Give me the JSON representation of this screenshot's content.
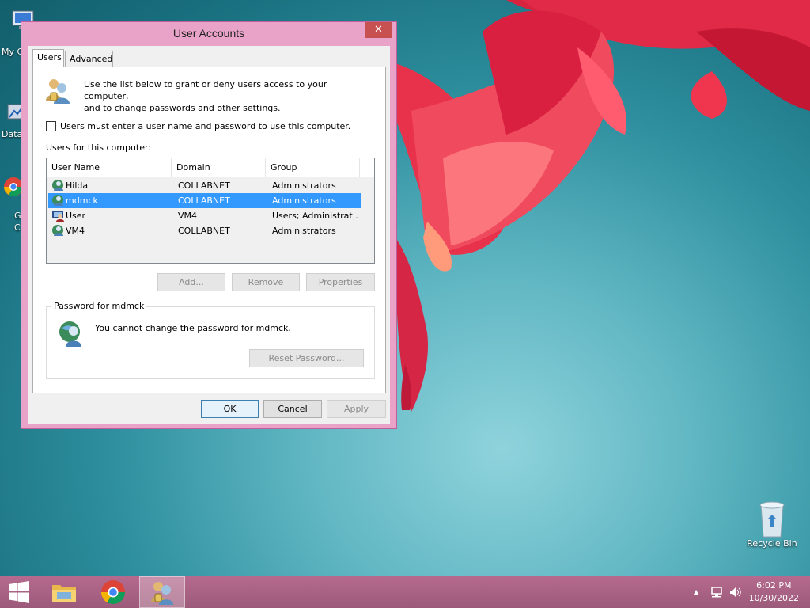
{
  "window": {
    "title": "User Accounts",
    "close_label": "✕",
    "tabs": [
      {
        "label": "Users"
      },
      {
        "label": "Advanced"
      }
    ],
    "intro_line1": "Use the list below to grant or deny users access to your computer,",
    "intro_line2": "and to change passwords and other settings.",
    "checkbox_label": "Users must enter a user name and password to use this computer.",
    "users_label": "Users for this computer:",
    "columns": [
      "User Name",
      "Domain",
      "Group"
    ],
    "users": [
      {
        "name": "Hilda",
        "domain": "COLLABNET",
        "group": "Administrators"
      },
      {
        "name": "mdmck",
        "domain": "COLLABNET",
        "group": "Administrators"
      },
      {
        "name": "User",
        "domain": "VM4",
        "group": "Users; Administrat..."
      },
      {
        "name": "VM4",
        "domain": "COLLABNET",
        "group": "Administrators"
      }
    ],
    "selected_user": "mdmck",
    "buttons": {
      "add": "Add...",
      "remove": "Remove",
      "properties": "Properties"
    },
    "password_group": "Password for mdmck",
    "password_info": "You cannot change the password for mdmck.",
    "reset_password": "Reset Password...",
    "ok": "OK",
    "cancel": "Cancel",
    "apply": "Apply"
  },
  "desktop": {
    "icons": [
      {
        "label": "My C"
      },
      {
        "label": "Data"
      },
      {
        "label": "G"
      },
      {
        "label": "C"
      }
    ],
    "recycle_bin": "Recycle Bin"
  },
  "taskbar": {
    "time": "6:02 PM",
    "date": "10/30/2022",
    "tray_arrow": "▲"
  },
  "colors": {
    "window_frame": "#e9a3c8",
    "selection": "#3399ff",
    "taskbar": "#a6607f"
  }
}
